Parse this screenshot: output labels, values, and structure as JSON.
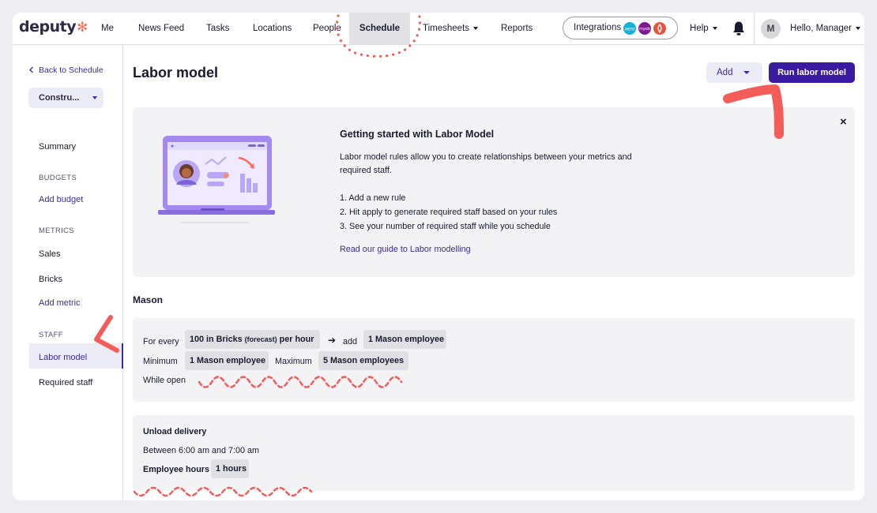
{
  "brand": {
    "name": "deputy",
    "mark": "✻"
  },
  "nav": {
    "items": [
      "Me",
      "News Feed",
      "Tasks",
      "Locations",
      "People",
      "Schedule",
      "Timesheets",
      "Reports"
    ],
    "active": "Schedule",
    "integrations_label": "Integrations",
    "integration_badges": [
      "xero",
      "myob",
      "toast"
    ],
    "help_label": "Help",
    "avatar_initial": "M",
    "greeting": "Hello, Manager"
  },
  "sidebar": {
    "back_label": "Back to Schedule",
    "project_selector": "Constru...",
    "summary": "Summary",
    "budgets_heading": "BUDGETS",
    "add_budget": "Add budget",
    "metrics_heading": "METRICS",
    "metrics": [
      "Sales",
      "Bricks"
    ],
    "add_metric": "Add metric",
    "staff_heading": "STAFF",
    "staff": [
      "Labor model",
      "Required staff"
    ],
    "active_item": "Labor model"
  },
  "page": {
    "title": "Labor model",
    "add_button": "Add",
    "run_button": "Run labor model"
  },
  "getting_started": {
    "title": "Getting started with Labor Model",
    "description": "Labor model rules allow you to create relationships between your metrics and required staff.",
    "steps": [
      "1. Add a new rule",
      "2. Hit apply to generate required staff based on your rules",
      "3. See your number of required staff while you schedule"
    ],
    "guide_link": "Read our guide to Labor modelling",
    "close_icon": "×"
  },
  "rules": [
    {
      "title": "Mason",
      "for_every_label": "For every",
      "metric_chip": "100 in Bricks",
      "metric_qualifier": "(forecast)",
      "metric_rate": "per hour",
      "arrow": "➔",
      "add_label": "add",
      "add_chip": "1 Mason employee",
      "minimum_label": "Minimum",
      "minimum_chip": "1 Mason employee",
      "maximum_label": "Maximum",
      "maximum_chip": "5 Mason employees",
      "condition": "While open"
    },
    {
      "title": "Unload delivery",
      "time_range": "Between 6:00 am and 7:00 am",
      "hours_label": "Employee hours",
      "hours_chip": "1 hours"
    }
  ],
  "colors": {
    "brand_purple": "#3a1ba1",
    "link_purple": "#3d2a9e",
    "annotation_red": "#f25d5a",
    "logo_star": "#ff6b57"
  }
}
